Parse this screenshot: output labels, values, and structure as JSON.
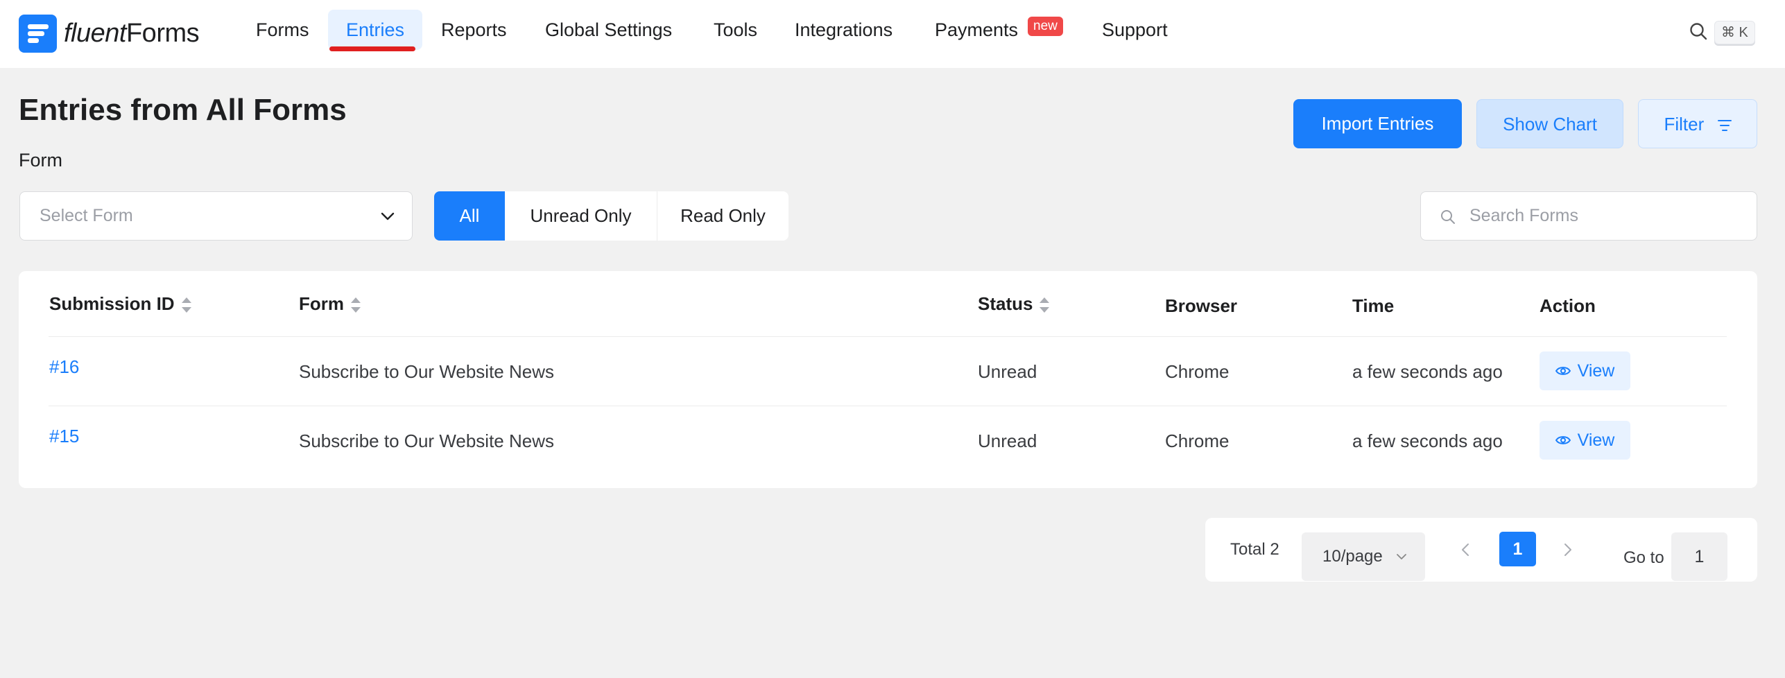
{
  "app": {
    "logo_italic": "fluent",
    "logo_bold": "Forms"
  },
  "nav": {
    "items": [
      {
        "label": "Forms"
      },
      {
        "label": "Entries"
      },
      {
        "label": "Reports"
      },
      {
        "label": "Global Settings"
      },
      {
        "label": "Tools"
      },
      {
        "label": "Integrations"
      },
      {
        "label": "Payments"
      },
      {
        "label": "Support"
      }
    ],
    "active": "Entries",
    "payments_badge": "new",
    "shortcut": "⌘ K"
  },
  "page": {
    "title": "Entries from All Forms",
    "form_label": "Form",
    "import_label": "Import Entries",
    "chart_label": "Show Chart",
    "filter_label": "Filter",
    "select_placeholder": "Select Form",
    "search_placeholder": "Search Forms",
    "segments": [
      "All",
      "Unread Only",
      "Read Only"
    ],
    "active_segment": "All"
  },
  "table": {
    "columns": [
      "Submission ID",
      "Form",
      "Status",
      "Browser",
      "Time",
      "Action"
    ],
    "rows": [
      {
        "id": "#16",
        "form": "Subscribe to Our Website News",
        "status": "Unread",
        "browser": "Chrome",
        "time": "a few seconds ago",
        "action": "View"
      },
      {
        "id": "#15",
        "form": "Subscribe to Our Website News",
        "status": "Unread",
        "browser": "Chrome",
        "time": "a few seconds ago",
        "action": "View"
      }
    ]
  },
  "pagination": {
    "total": "Total 2",
    "page_size": "10/page",
    "current_page": "1",
    "goto_label": "Go to",
    "goto_value": "1"
  },
  "colors": {
    "accent": "#1a7efb",
    "active_underline": "#e02020",
    "badge": "#f04848",
    "background": "#f1f1f1"
  }
}
